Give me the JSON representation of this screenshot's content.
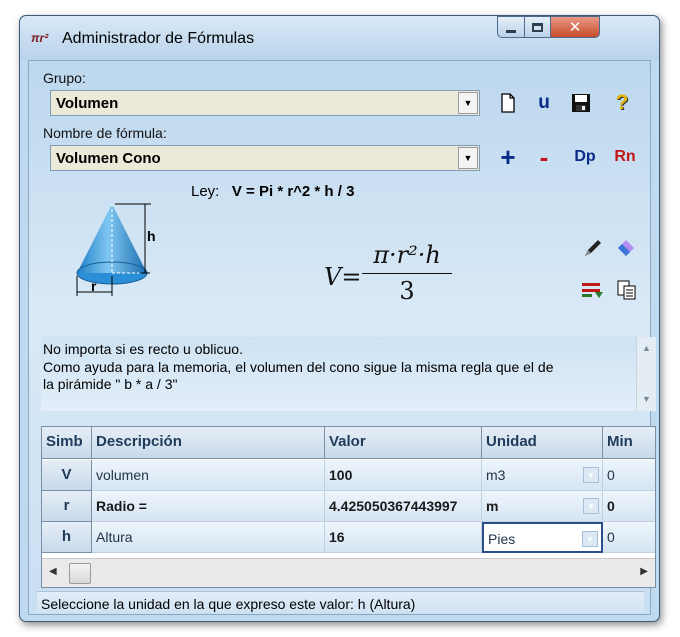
{
  "window": {
    "title": "Administrador de Fórmulas",
    "app_icon": "πr²"
  },
  "title_buttons": {
    "close": "✕"
  },
  "grupo": {
    "label": "Grupo:",
    "value": "Volumen"
  },
  "nombre": {
    "label": "Nombre de fórmula:",
    "value": "Volumen Cono"
  },
  "toolbar_row1": [
    {
      "icon": "new-document-icon",
      "glyph": "🗋"
    },
    {
      "icon": "u-icon",
      "glyph": "u"
    },
    {
      "icon": "save-icon",
      "glyph": "💾"
    },
    {
      "icon": "help-icon",
      "glyph": "?"
    }
  ],
  "toolbar_row2": [
    {
      "icon": "plus-icon",
      "glyph": "+"
    },
    {
      "icon": "minus-icon",
      "glyph": "-"
    },
    {
      "icon": "dp-icon",
      "glyph": "Dp"
    },
    {
      "icon": "rn-icon",
      "glyph": "Rn"
    }
  ],
  "law": {
    "prefix": "Ley:",
    "expression": "V = Pi * r^2 * h / 3"
  },
  "diagram": {
    "height_label": "h",
    "radius_label": "r"
  },
  "formula": {
    "lhs": "V=",
    "numerator": "π·r²·h",
    "denominator": "3"
  },
  "notes": {
    "line1": "No importa si es recto u oblicuo.",
    "line2": "Como ayuda para la memoria, el volumen del cono sigue la misma regla que el de",
    "line3": "la pirámide \" b * a / 3\""
  },
  "table": {
    "headers": [
      "Simb",
      "Descripción",
      "Valor",
      "Unidad",
      "Min"
    ],
    "rows": [
      {
        "simb": "V",
        "desc": "volumen",
        "valor": "100",
        "unidad": "m3",
        "min": "0"
      },
      {
        "simb": "r",
        "desc": "Radio =",
        "valor": "4.425050367443997",
        "unidad": "m",
        "min": "0"
      },
      {
        "simb": "h",
        "desc": "Altura",
        "valor": "16",
        "unidad": "Pies",
        "min": "0"
      }
    ]
  },
  "status": "Seleccione la unidad en la que expreso este valor:  h (Altura)",
  "colors": {
    "accent_blue": "#0a2a8a",
    "accent_red": "#c01717",
    "window_bg": "#bfd9ee"
  }
}
